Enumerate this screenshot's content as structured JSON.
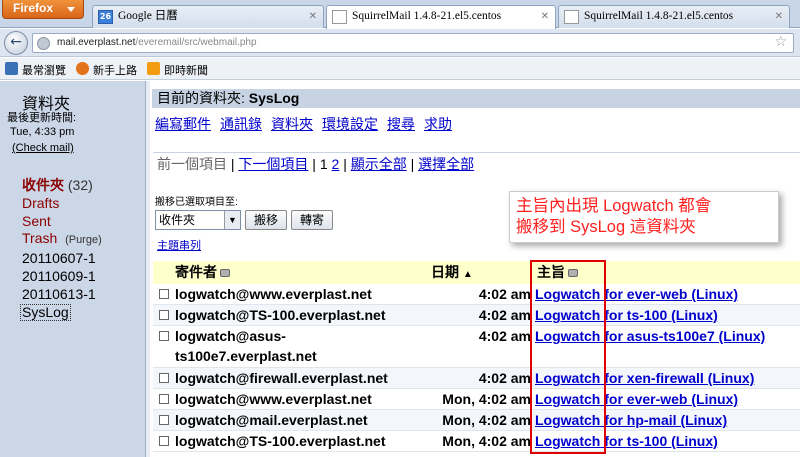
{
  "browser": {
    "menu_button": "Firefox",
    "tabs": [
      {
        "title": "Google 日曆",
        "favicon": "26"
      },
      {
        "title": "SquirrelMail 1.4.8-21.el5.centos"
      },
      {
        "title": "SquirrelMail 1.4.8-21.el5.centos"
      }
    ],
    "url_domain": "mail.everplast.net",
    "url_path": "/everemail/src/webmail.php",
    "bookmarks": [
      "最常瀏覽",
      "新手上路",
      "即時新聞"
    ]
  },
  "sidebar": {
    "title": "資料夾",
    "last_updated_label": "最後更新時間:",
    "last_updated_time": "Tue, 4:33 pm",
    "check_mail": "(Check mail)",
    "folders": {
      "inbox": "收件夾",
      "inbox_count": "(32)",
      "drafts": "Drafts",
      "sent": "Sent",
      "trash": "Trash",
      "purge": "(Purge)",
      "f1": "20110607-1",
      "f2": "20110609-1",
      "f3": "20110613-1",
      "syslog": "SysLog"
    }
  },
  "main": {
    "current_folder_label": "目前的資料夾:",
    "current_folder": "SysLog",
    "menu": [
      "編寫郵件",
      "通訊錄",
      "資料夾",
      "環境設定",
      "搜尋",
      "求助"
    ],
    "pager": {
      "prev": "前一個項目",
      "sep1": " | ",
      "next": "下一個項目",
      "sep2": " | ",
      "page1": "1",
      "page2": "2",
      "sep3": " | ",
      "show_all": "顯示全部",
      "sep4": " | ",
      "select_all": "選擇全部"
    },
    "move_label": "搬移已選取項目至:",
    "move_target": "收件夾",
    "move_button": "搬移",
    "forward_button": "轉寄",
    "thread_link": "主題串列",
    "annotation_line1": "主旨內出現 Logwatch 都會",
    "annotation_line2": "搬移到 SysLog 這資料夾",
    "table": {
      "headers": {
        "from": "寄件者",
        "date": "日期",
        "subject": "主旨"
      },
      "rows": [
        {
          "from": "logwatch@www.everplast.net",
          "date": "4:02 am",
          "subj1": "Logwatch",
          "subj2": " for ever-web (Linux)"
        },
        {
          "from": "logwatch@TS-100.everplast.net",
          "date": "4:02 am",
          "subj1": "Logwatch",
          "subj2": " for ts-100 (Linux)"
        },
        {
          "from": "logwatch@asus-ts100e7.everplast.net",
          "date": "4:02 am",
          "subj1": "Logwatch",
          "subj2": " for asus-ts100e7 (Linux)"
        },
        {
          "from": "logwatch@firewall.everplast.net",
          "date": "4:02 am",
          "subj1": "Logwatch",
          "subj2": " for xen-firewall (Linux)"
        },
        {
          "from": "logwatch@www.everplast.net",
          "date": "Mon, 4:02 am",
          "subj1": "Logwatch",
          "subj2": " for ever-web (Linux)"
        },
        {
          "from": "logwatch@mail.everplast.net",
          "date": "Mon, 4:02 am",
          "subj1": "Logwatch",
          "subj2": " for hp-mail (Linux)"
        },
        {
          "from": "logwatch@TS-100.everplast.net",
          "date": "Mon, 4:02 am",
          "subj1": "Logwatch",
          "subj2": " for ts-100 (Linux)"
        }
      ]
    }
  }
}
